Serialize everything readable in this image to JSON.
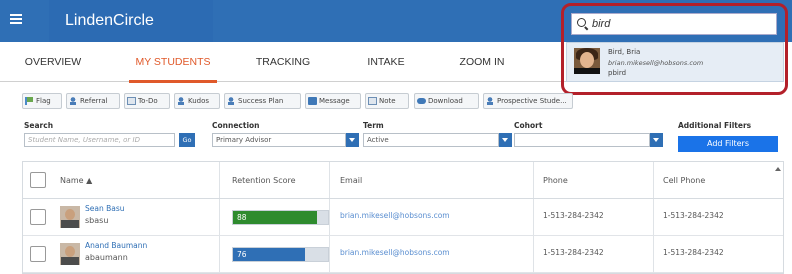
{
  "header": {
    "app_name": "LindenCircle",
    "search": {
      "value": "bird"
    }
  },
  "search_result": {
    "name": "Bird, Bria",
    "email": "brian.mikesell@hobsons.com",
    "username": "pbird"
  },
  "tabs": [
    {
      "label": "OVERVIEW",
      "active": false
    },
    {
      "label": "MY STUDENTS",
      "active": true
    },
    {
      "label": "TRACKING",
      "active": false
    },
    {
      "label": "INTAKE",
      "active": false
    },
    {
      "label": "ZOOM IN",
      "active": false
    }
  ],
  "toolbar": {
    "buttons": [
      "Flag",
      "Referral",
      "To-Do",
      "Kudos",
      "Success Plan",
      "Message",
      "Note",
      "Download",
      "Prospective Stude..."
    ]
  },
  "filters": {
    "search_label": "Search",
    "search_placeholder": "Student Name, Username, or ID",
    "go_label": "Go",
    "connection_label": "Connection",
    "connection_value": "Primary Advisor",
    "term_label": "Term",
    "term_value": "Active",
    "cohort_label": "Cohort",
    "cohort_value": "",
    "additional_label": "Additional Filters",
    "add_filters_button": "Add Filters"
  },
  "table": {
    "columns": [
      "Name ▲",
      "Retention Score",
      "Email",
      "Phone",
      "Cell Phone"
    ],
    "rows": [
      {
        "name": "Sean Basu",
        "username": "sbasu",
        "score": 88,
        "score_color": "#2e8b2e",
        "email": "brian.mikesell@hobsons.com",
        "phone": "1-513-284-2342",
        "cell": "1-513-284-2342"
      },
      {
        "name": "Anand Baumann",
        "username": "abaumann",
        "score": 76,
        "score_color": "#2f6fb5",
        "email": "brian.mikesell@hobsons.com",
        "phone": "1-513-284-2342",
        "cell": "1-513-284-2342"
      }
    ]
  },
  "colors": {
    "header_blue": "#2f6fb5",
    "active_tab": "#e0592a",
    "highlight": "#b3202a",
    "button_blue": "#1a73e8"
  }
}
